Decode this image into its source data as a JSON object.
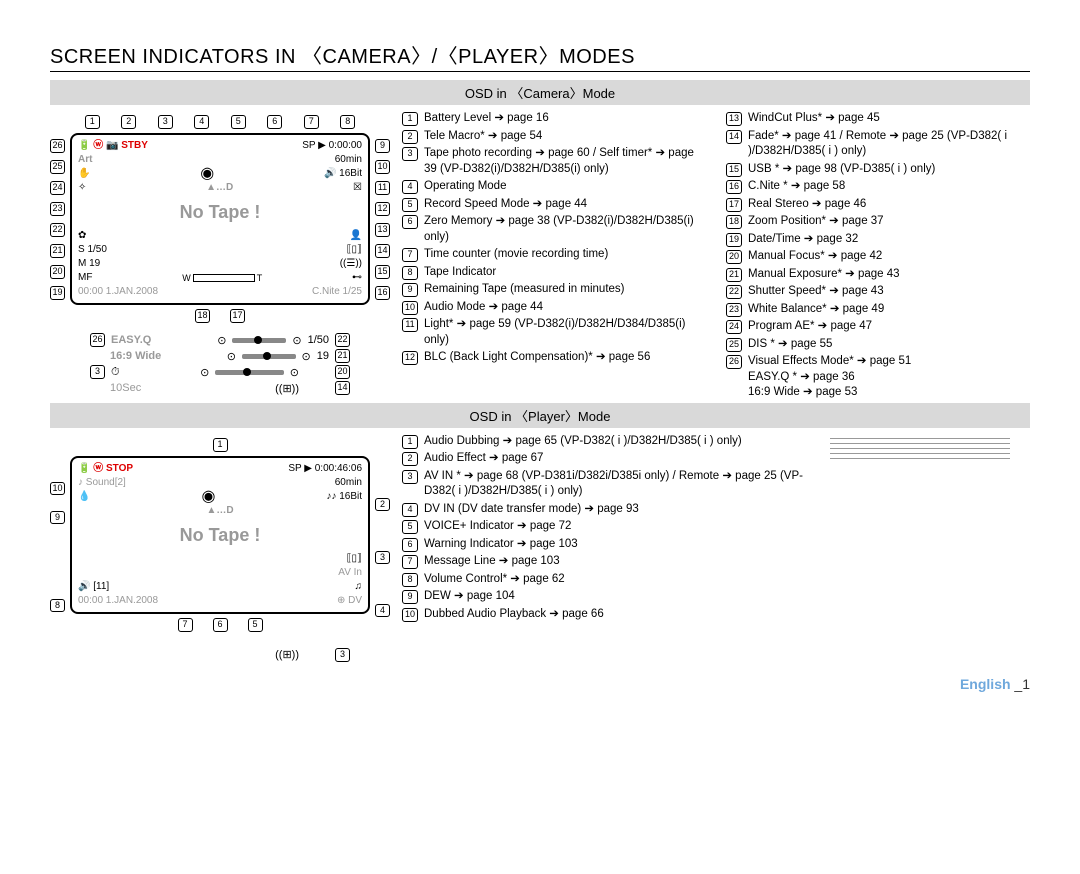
{
  "title": "SCREEN INDICATORS IN 〈CAMERA〉/〈PLAYER〉MODES",
  "section_camera": "OSD in 〈Camera〉Mode",
  "section_player": "OSD in 〈Player〉Mode",
  "camera_left_callouts": [
    "26",
    "25",
    "24",
    "23",
    "22",
    "21",
    "20",
    "19"
  ],
  "camera_top_callouts": [
    "1",
    "2",
    "3",
    "4",
    "5",
    "6",
    "7",
    "8"
  ],
  "camera_right_callouts": [
    "9",
    "10",
    "11",
    "12",
    "13",
    "14",
    "15",
    "16"
  ],
  "camera_bottom_callouts": [
    "18",
    "17"
  ],
  "lcd_camera": {
    "row1_left": "🔋  ⓦ  📷  STBY",
    "row1_right": "SP ▶ 0:00:00",
    "art": "Art",
    "sixtymin": "60min",
    "sixteenbit": "🔊 16Bit",
    "eject": "▲…D",
    "notape": "No Tape !",
    "mf": "MF",
    "m19": "M 19",
    "s150": "S 1/50",
    "zoom_w": "W",
    "zoom_t": "T",
    "datetime": "00:00  1.JAN.2008",
    "cnite": "C.Nite 1/25"
  },
  "sliders_block": {
    "easyq_num": "26",
    "easyq": "EASY.Q",
    "wide169": "16:9 Wide",
    "ten_sec_num": "3",
    "ten_sec": "10Sec",
    "s150": "1/50",
    "s150_num": "22",
    "v19": "19",
    "v19_num": "21",
    "r20_num": "20",
    "r14_num": "14"
  },
  "camera_list_left": [
    {
      "n": "1",
      "t": "Battery Level ➔ page 16"
    },
    {
      "n": "2",
      "t": "Tele Macro* ➔ page 54"
    },
    {
      "n": "3",
      "t": "Tape photo recording ➔ page 60 / Self timer* ➔ page 39 (VP-D382(i)/D382H/D385(i) only)"
    },
    {
      "n": "4",
      "t": "Operating Mode"
    },
    {
      "n": "5",
      "t": "Record Speed Mode ➔ page 44"
    },
    {
      "n": "6",
      "t": "Zero Memory ➔ page 38 (VP-D382(i)/D382H/D385(i) only)"
    },
    {
      "n": "7",
      "t": "Time counter (movie recording time)"
    },
    {
      "n": "8",
      "t": "Tape Indicator"
    },
    {
      "n": "9",
      "t": "Remaining Tape (measured in minutes)"
    },
    {
      "n": "10",
      "t": "Audio Mode ➔ page 44"
    },
    {
      "n": "11",
      "t": "Light* ➔ page 59 (VP-D382(i)/D382H/D384/D385(i) only)"
    },
    {
      "n": "12",
      "t": "BLC (Back Light Compensation)* ➔ page 56"
    }
  ],
  "camera_list_right": [
    {
      "n": "13",
      "t": "WindCut Plus* ➔ page 45"
    },
    {
      "n": "14",
      "t": "Fade* ➔ page 41 / Remote ➔ page 25 (VP-D382( i )/D382H/D385( i ) only)"
    },
    {
      "n": "15",
      "t": "USB * ➔ page 98 (VP-D385( i ) only)"
    },
    {
      "n": "16",
      "t": "C.Nite * ➔ page 58"
    },
    {
      "n": "17",
      "t": "Real Stereo ➔ page 46"
    },
    {
      "n": "18",
      "t": "Zoom Position* ➔ page 37"
    },
    {
      "n": "19",
      "t": "Date/Time ➔ page 32"
    },
    {
      "n": "20",
      "t": "Manual Focus* ➔ page 42"
    },
    {
      "n": "21",
      "t": "Manual Exposure* ➔ page 43"
    },
    {
      "n": "22",
      "t": "Shutter Speed* ➔ page 43"
    },
    {
      "n": "23",
      "t": "White Balance* ➔ page 49"
    },
    {
      "n": "24",
      "t": "Program AE* ➔ page 47"
    },
    {
      "n": "25",
      "t": "DIS * ➔ page 55"
    },
    {
      "n": "26",
      "t": "Visual Effects Mode* ➔ page 51\nEASY.Q * ➔ page 36\n16:9 Wide ➔ page 53"
    }
  ],
  "player_top_callouts": [
    "1"
  ],
  "player_left_callouts": [
    "10",
    "9",
    "8"
  ],
  "player_right_callouts": [
    "2",
    "3",
    "4"
  ],
  "player_bottom_callouts": [
    "7",
    "6",
    "5"
  ],
  "lcd_player": {
    "row1_left": "🔋  ⓦ  STOP",
    "row1_right": "SP ▶ 0:00:46:06",
    "soundz": "♪ Sound[2]",
    "sixtymin": "60min",
    "sixteenbit": "♪♪ 16Bit",
    "eject": "▲…D",
    "notape": "No Tape !",
    "avin": "AV In",
    "vol": "🔊 [11]",
    "datetime": "00:00  1.JAN.2008",
    "dv": "⊕ DV"
  },
  "player_sliders": {
    "r3_num": "3"
  },
  "player_list": [
    {
      "n": "1",
      "t": "Audio Dubbing ➔ page 65 (VP-D382( i )/D382H/D385( i ) only)"
    },
    {
      "n": "2",
      "t": "Audio Effect ➔ page 67"
    },
    {
      "n": "3",
      "t": "AV IN * ➔ page 68 (VP-D381i/D382i/D385i only) / Remote ➔ page 25 (VP-D382( i )/D382H/D385( i ) only)"
    },
    {
      "n": "4",
      "t": "DV IN (DV date transfer mode) ➔ page 93"
    },
    {
      "n": "5",
      "t": "VOICE+ Indicator ➔ page 72"
    },
    {
      "n": "6",
      "t": "Warning Indicator ➔ page 103"
    },
    {
      "n": "7",
      "t": "Message Line ➔ page 103"
    },
    {
      "n": "8",
      "t": "Volume Control* ➔ page 62"
    },
    {
      "n": "9",
      "t": "DEW ➔ page 104"
    },
    {
      "n": "10",
      "t": "Dubbed Audio Playback ➔ page 66"
    }
  ],
  "footer": {
    "lang": "English",
    "page": "_1"
  }
}
